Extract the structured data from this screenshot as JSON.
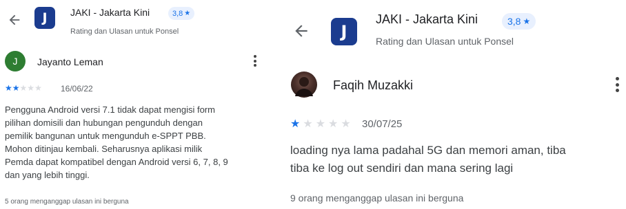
{
  "left_review": {
    "app_name": "JAKI - Jakarta Kini",
    "app_icon_letter": "J",
    "rating": "3,8",
    "subtitle": "Rating dan Ulasan untuk Ponsel",
    "reviewer_initial": "J",
    "reviewer": "Jayanto Leman",
    "stars_filled": 2,
    "stars_total": 5,
    "date": "16/06/22",
    "body_lines": [
      "Pengguna Android versi 7.1 tidak dapat mengisi form",
      "pilihan domisili dan hubungan pengunduh dengan",
      "pemilik bangunan untuk mengunduh e-SPPT PBB.",
      "Mohon ditinjau kembali. Seharusnya aplikasi milik",
      "Pemda dapat kompatibel dengan Android versi 6, 7, 8, 9",
      "dan yang lebih tinggi."
    ],
    "helpful": "5 orang menganggap ulasan ini berguna"
  },
  "right_review": {
    "app_name": "JAKI - Jakarta Kini",
    "app_icon_letter": "J",
    "rating": "3,8",
    "subtitle": "Rating dan Ulasan untuk Ponsel",
    "reviewer": "Faqih Muzakki",
    "stars_filled": 1,
    "stars_total": 5,
    "date": "30/07/25",
    "body_lines": [
      "loading nya lama padahal 5G dan memori aman, tiba",
      "tiba ke log out sendiri dan mana sering lagi"
    ],
    "helpful": "9 orang menganggap ulasan ini berguna"
  },
  "colors": {
    "accent": "#1a73e8",
    "app_icon_bg": "#1b3c8f",
    "left_avatar_bg": "#2e7d32",
    "star_empty": "#dadce0"
  },
  "icons": [
    "back-arrow-icon",
    "star-icon",
    "more-vert-icon"
  ]
}
